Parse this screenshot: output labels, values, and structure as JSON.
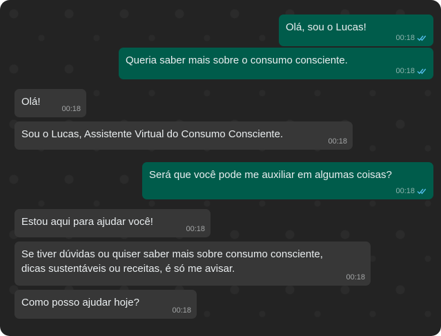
{
  "theme": {
    "background": "#232323",
    "outgoing_bubble": "#005c4b",
    "incoming_bubble": "#373737",
    "read_receipt": "#53bdeb"
  },
  "messages": [
    {
      "direction": "out",
      "text": "Olá, sou o Lucas!",
      "time": "00:18",
      "status_icon": "double-check-icon"
    },
    {
      "direction": "out",
      "text": "Queria saber mais sobre o consumo consciente.",
      "time": "00:18",
      "status_icon": "double-check-icon"
    },
    {
      "direction": "in",
      "text": "Olá!",
      "time": "00:18"
    },
    {
      "direction": "in",
      "text": "Sou o Lucas, Assistente Virtual do Consumo Consciente.",
      "time": "00:18"
    },
    {
      "direction": "out",
      "text": "Será que você pode me auxiliar em algumas coisas?",
      "time": "00:18",
      "status_icon": "double-check-icon"
    },
    {
      "direction": "in",
      "text": "Estou aqui para ajudar você!",
      "time": "00:18"
    },
    {
      "direction": "in",
      "text": "Se tiver dúvidas ou quiser saber mais sobre consumo consciente,\ndicas sustentáveis ou receitas, é só me avisar.",
      "time": "00:18"
    },
    {
      "direction": "in",
      "text": "Como posso ajudar hoje?",
      "time": "00:18"
    }
  ]
}
